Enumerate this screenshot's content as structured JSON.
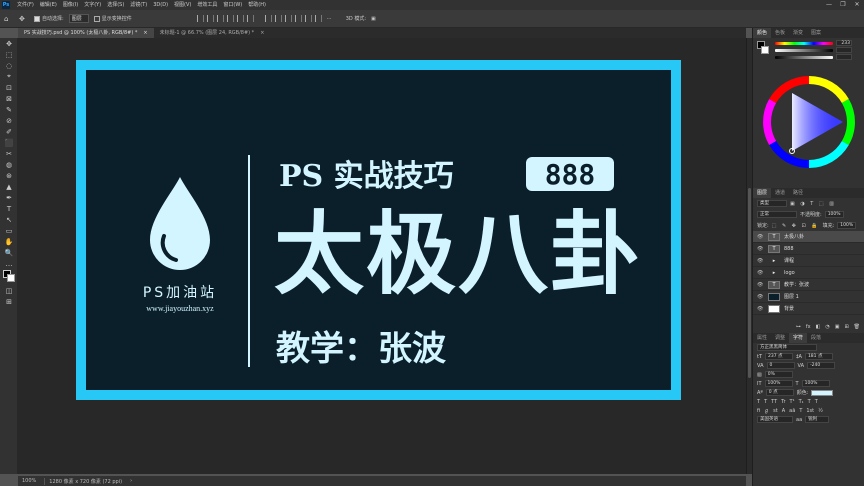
{
  "menubar": {
    "logo": "Ps",
    "items": [
      "文件(F)",
      "编辑(E)",
      "图像(I)",
      "文字(Y)",
      "选择(S)",
      "滤镜(T)",
      "3D(D)",
      "视图(V)",
      "增效工具",
      "窗口(W)",
      "帮助(H)"
    ],
    "win_min": "—",
    "win_max": "❐",
    "win_close": "✕"
  },
  "options": {
    "move_icon": "✥",
    "auto_select_label": "自动选择:",
    "auto_select_value": "图层",
    "show_transform_label": "显示变换控件",
    "more": "···",
    "mode_3d": "3D 模式:",
    "cube_icon": "▣"
  },
  "tabs": [
    {
      "label": "PS 实战技巧.psd @ 100% (太极八卦, RGB/8#) *",
      "close": "×"
    },
    {
      "label": "未标题-1 @ 66.7% (图层 24, RGB/8#) *",
      "close": "×"
    }
  ],
  "tools": [
    "✥",
    "⬚",
    "◌",
    "⌖",
    "⊡",
    "⊠",
    "✎",
    "⊘",
    "✐",
    "⬛",
    "✂",
    "◍",
    "⊛",
    "▲",
    "✒",
    "T",
    "↖",
    "▭",
    "✋",
    "🔍",
    "…",
    "◧",
    "◫",
    "⊞"
  ],
  "artwork": {
    "logo_text": "PS加油站",
    "url": "www.jiayouzhan.xyz",
    "line1": "PS 实战技巧",
    "number": "888",
    "main": "太极八卦",
    "byline": "教学：张波"
  },
  "status": {
    "zoom": "100%",
    "doc": "1280 像素 x 720 像素 (72 ppi)",
    "arrow": "›"
  },
  "color_panel": {
    "tabs": [
      "颜色",
      "色板",
      "渐变",
      "图案"
    ],
    "r_val": "233",
    "g_val": "",
    "b_val": "",
    "mark": "#"
  },
  "layers_panel": {
    "tabs": [
      "图层",
      "通道",
      "路径"
    ],
    "kind": "类型",
    "blend": "正常",
    "opacity_label": "不透明度:",
    "opacity": "100%",
    "lock_label": "锁定:",
    "fill_label": "填充:",
    "fill": "100%",
    "layers": [
      {
        "name": "太极八卦",
        "thumb": "T",
        "selected": true
      },
      {
        "name": "888",
        "thumb": "T",
        "selected": false
      },
      {
        "name": "课程",
        "thumb": "▸",
        "selected": false
      },
      {
        "name": "logo",
        "thumb": "▸",
        "selected": false
      },
      {
        "name": "教学：张波",
        "thumb": "T",
        "selected": false
      },
      {
        "name": "图层 1",
        "thumb": "",
        "selected": false
      },
      {
        "name": "背景",
        "thumb": "",
        "selected": false
      }
    ],
    "footer": [
      "⊶",
      "fx",
      "◧",
      "◔",
      "▣",
      "⊞",
      "🗑"
    ]
  },
  "char_panel": {
    "tabs": [
      "属性",
      "调整",
      "字符",
      "段落"
    ],
    "font": "方正黑黑简体",
    "size": "237 点",
    "leading": "181 点",
    "kern": "0",
    "tracking": "-240",
    "scale": "0%",
    "vscale": "100%",
    "hscale": "100%",
    "baseline": "0 点",
    "color_label": "颜色:",
    "styles": [
      "T",
      "T",
      "TT",
      "Tr",
      "T¹",
      "T₁",
      "T",
      "T"
    ],
    "extra": [
      "fi",
      "ℊ",
      "st",
      "A",
      "aā",
      "T",
      "1st",
      "½"
    ],
    "lang": "美国英语",
    "aa": "锐利"
  },
  "colors": {
    "frame": "#27c7f6",
    "doc_bg": "#0a1f2a",
    "text": "#d3f5ff"
  }
}
